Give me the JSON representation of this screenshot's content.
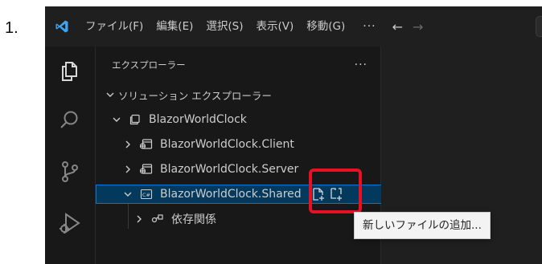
{
  "step": {
    "number": "1."
  },
  "menu": {
    "items": [
      {
        "label": "ファイル(F)"
      },
      {
        "label": "編集(E)"
      },
      {
        "label": "選択(S)"
      },
      {
        "label": "表示(V)"
      },
      {
        "label": "移動(G)"
      }
    ],
    "more": "···",
    "back_arrow": "←",
    "forward_arrow": "→"
  },
  "activity_bar": {
    "icons": [
      "explorer-icon",
      "search-icon",
      "source-control-icon",
      "run-debug-icon"
    ]
  },
  "sidebar": {
    "title": "エクスプローラー",
    "more": "···",
    "section": "ソリューション エクスプローラー",
    "tree": [
      {
        "label": "BlazorWorldClock",
        "icon": "solution-icon",
        "expanded": true
      },
      {
        "label": "BlazorWorldClock.Client",
        "icon": "project-icon",
        "expanded": false
      },
      {
        "label": "BlazorWorldClock.Server",
        "icon": "project-icon",
        "expanded": false
      },
      {
        "label": "BlazorWorldClock.Shared",
        "icon": "csharp-project-icon",
        "expanded": true,
        "selected": true
      },
      {
        "label": "依存関係",
        "icon": "dependencies-icon",
        "expanded": false
      }
    ],
    "row_actions": [
      "new-file-icon",
      "new-folder-icon"
    ]
  },
  "tooltip": {
    "text": "新しいファイルの追加..."
  },
  "colors": {
    "selection_bg": "#04395e",
    "selection_border": "#0078d4",
    "highlight": "#e81123",
    "vscode_blue": "#3da5f4"
  }
}
